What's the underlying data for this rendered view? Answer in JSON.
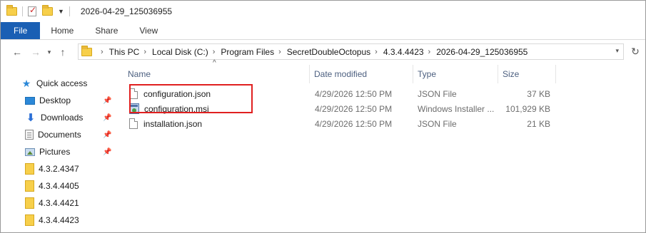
{
  "window": {
    "title": "2026-04-29_125036955"
  },
  "ribbon": {
    "tabs": [
      "File",
      "Home",
      "Share",
      "View"
    ]
  },
  "address": {
    "crumbs": [
      "This PC",
      "Local Disk (C:)",
      "Program Files",
      "SecretDoubleOctopus",
      "4.3.4.4423",
      "2026-04-29_125036955"
    ]
  },
  "icons": {
    "back": "back-arrow-icon",
    "forward": "forward-arrow-icon",
    "up": "up-arrow-icon",
    "refresh": "refresh-icon",
    "quick_access": "star-icon",
    "pin": "pin-icon"
  },
  "sidebar": {
    "items": [
      {
        "label": "Quick access",
        "icon": "star-icon",
        "pinned": false
      },
      {
        "label": "Desktop",
        "icon": "desktop-icon",
        "pinned": true
      },
      {
        "label": "Downloads",
        "icon": "downloads-icon",
        "pinned": true
      },
      {
        "label": "Documents",
        "icon": "documents-icon",
        "pinned": true
      },
      {
        "label": "Pictures",
        "icon": "pictures-icon",
        "pinned": true
      },
      {
        "label": "4.3.2.4347",
        "icon": "folder-icon",
        "pinned": false
      },
      {
        "label": "4.3.4.4405",
        "icon": "folder-icon",
        "pinned": false
      },
      {
        "label": "4.3.4.4421",
        "icon": "folder-icon",
        "pinned": false
      },
      {
        "label": "4.3.4.4423",
        "icon": "folder-icon",
        "pinned": false
      }
    ]
  },
  "list": {
    "columns": {
      "name": "Name",
      "date": "Date modified",
      "type": "Type",
      "size": "Size"
    },
    "rows": [
      {
        "name": "configuration.json",
        "date": "4/29/2026 12:50 PM",
        "type": "JSON File",
        "size": "37 KB",
        "icon": "file-icon"
      },
      {
        "name": "configuration.msi",
        "date": "4/29/2026 12:50 PM",
        "type": "Windows Installer ...",
        "size": "101,929 KB",
        "icon": "installer-icon"
      },
      {
        "name": "installation.json",
        "date": "4/29/2026 12:50 PM",
        "type": "JSON File",
        "size": "21 KB",
        "icon": "file-icon"
      }
    ]
  },
  "colors": {
    "file_tab": "#1a5fb4",
    "highlight": "#e02020",
    "column_header": "#4d6080"
  }
}
